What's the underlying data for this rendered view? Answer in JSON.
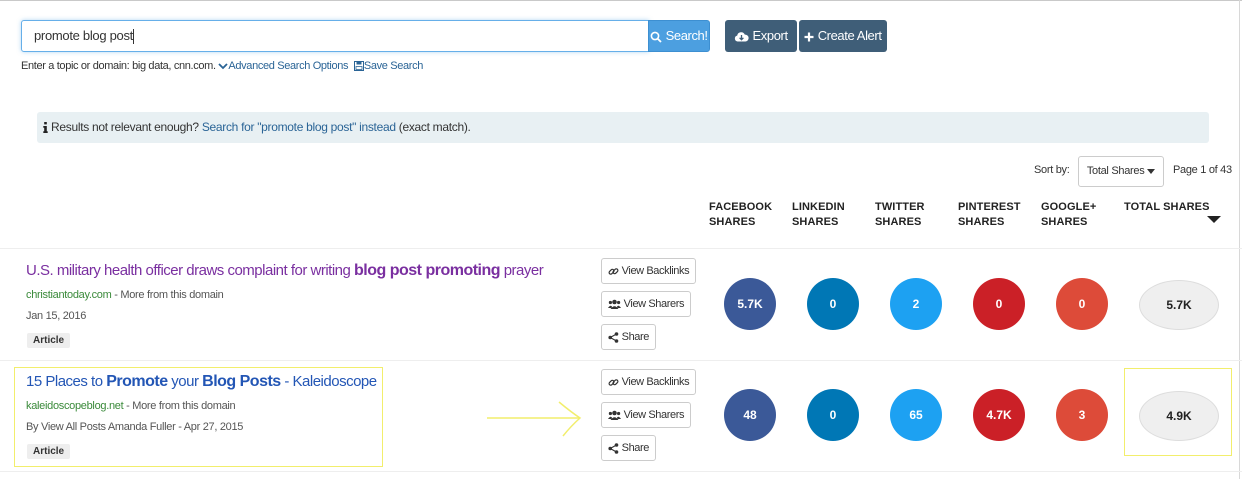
{
  "search": {
    "value": "promote blog post",
    "button_label": "Search!",
    "export_label": "Export",
    "create_alert_label": "Create Alert",
    "hint_text": "Enter a topic or domain: big data, cnn.com.",
    "advanced_label": "Advanced Search Options",
    "save_label": "Save Search"
  },
  "notice": {
    "prefix": "Results not relevant enough?",
    "link": "Search for \"promote blog post\" instead",
    "suffix": "(exact match)."
  },
  "sort": {
    "label": "Sort by:",
    "selected": "Total Shares",
    "page": "Page 1 of 43"
  },
  "columns": [
    {
      "line1": "FACEBOOK",
      "line2": "SHARES"
    },
    {
      "line1": "LINKEDIN",
      "line2": "SHARES"
    },
    {
      "line1": "TWITTER",
      "line2": "SHARES"
    },
    {
      "line1": "PINTEREST",
      "line2": "SHARES"
    },
    {
      "line1": "GOOGLE+",
      "line2": "SHARES"
    },
    {
      "line1": "TOTAL SHARES",
      "line2": ""
    }
  ],
  "actions": {
    "backlinks": "View Backlinks",
    "sharers": "View Sharers",
    "share": "Share"
  },
  "results": [
    {
      "title_pre": "U.S. military health officer draws complaint for writing ",
      "title_bold1": "blog post promoting",
      "title_mid": " prayer",
      "title_bold2": "",
      "title_post": "",
      "domain": "christiantoday.com",
      "more": " - More from this domain",
      "meta": "Jan 15, 2016",
      "badge": "Article",
      "facebook": "5.7K",
      "linkedin": "0",
      "twitter": "2",
      "pinterest": "0",
      "googleplus": "0",
      "total": "5.7K"
    },
    {
      "title_pre": "15 Places to ",
      "title_bold1": "Promote",
      "title_mid": " your ",
      "title_bold2": "Blog Posts",
      "title_post": " - Kaleidoscope",
      "domain": "kaleidoscopeblog.net",
      "more": " - More from this domain",
      "meta": "By View All Posts Amanda Fuller - Apr 27, 2015",
      "badge": "Article",
      "facebook": "48",
      "linkedin": "0",
      "twitter": "65",
      "pinterest": "4.7K",
      "googleplus": "3",
      "total": "4.9K"
    }
  ],
  "colors": {
    "facebook": "#3b5998",
    "linkedin": "#0077b5",
    "twitter": "#1da1f2",
    "pinterest": "#cb2027",
    "googleplus": "#dd4b39",
    "highlight": "#f2ee6c"
  },
  "icons": [
    "search-icon",
    "cloud-download-icon",
    "plus-icon",
    "chevron-down-icon",
    "save-icon",
    "info-icon",
    "caret-down-icon",
    "link-icon",
    "users-icon",
    "share-icon",
    "arrow-right-icon"
  ]
}
